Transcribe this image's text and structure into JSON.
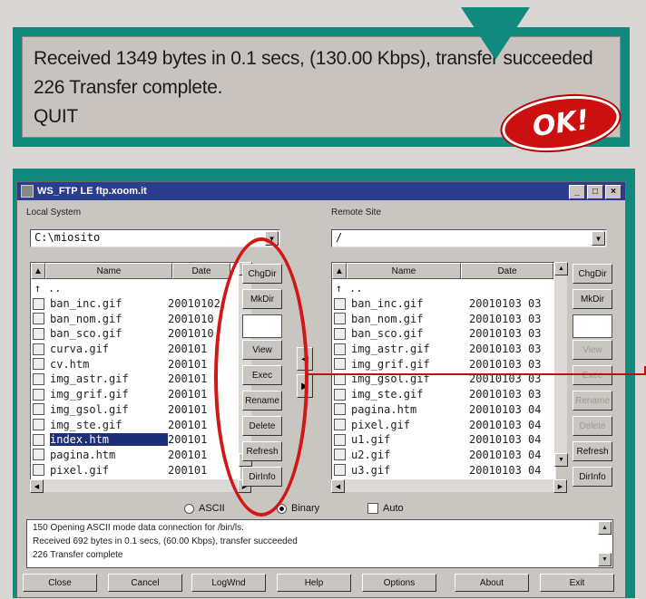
{
  "status": {
    "lines": [
      "Received 1349 bytes in 0.1 secs, (130.00 Kbps), transfer succeeded",
      "226 Transfer complete.",
      "QUIT"
    ],
    "badge": "OK!"
  },
  "window": {
    "title": "WS_FTP LE ftp.xoom.it",
    "controls": [
      "_",
      "□",
      "×"
    ]
  },
  "local": {
    "label": "Local System",
    "path": "C:\\miosito",
    "headers": [
      "Name",
      "Date"
    ],
    "files": [
      {
        "name": "..",
        "date": ""
      },
      {
        "name": "ban_inc.gif",
        "date": "20010102"
      },
      {
        "name": "ban_nom.gif",
        "date": "2001010"
      },
      {
        "name": "ban_sco.gif",
        "date": "2001010"
      },
      {
        "name": "curva.gif",
        "date": "200101"
      },
      {
        "name": "cv.htm",
        "date": "200101"
      },
      {
        "name": "img_astr.gif",
        "date": "200101"
      },
      {
        "name": "img_grif.gif",
        "date": "200101"
      },
      {
        "name": "img_gsol.gif",
        "date": "200101"
      },
      {
        "name": "img_ste.gif",
        "date": "200101"
      },
      {
        "name": "index.htm",
        "date": "200101"
      },
      {
        "name": "pagina.htm",
        "date": "200101"
      },
      {
        "name": "pixel.gif",
        "date": "200101"
      }
    ],
    "buttons": [
      "ChgDir",
      "MkDir",
      "",
      "View",
      "Exec",
      "Rename",
      "Delete",
      "Refresh",
      "DirInfo"
    ]
  },
  "remote": {
    "label": "Remote Site",
    "path": "/",
    "headers": [
      "Name",
      "Date"
    ],
    "files": [
      {
        "name": "..",
        "date": ""
      },
      {
        "name": "ban_inc.gif",
        "date": "20010103 03"
      },
      {
        "name": "ban_nom.gif",
        "date": "20010103 03"
      },
      {
        "name": "ban_sco.gif",
        "date": "20010103 03"
      },
      {
        "name": "img_astr.gif",
        "date": "20010103 03"
      },
      {
        "name": "img_grif.gif",
        "date": "20010103 03"
      },
      {
        "name": "img_gsol.gif",
        "date": "20010103 03"
      },
      {
        "name": "img_ste.gif",
        "date": "20010103 03"
      },
      {
        "name": "pagina.htm",
        "date": "20010103 04"
      },
      {
        "name": "pixel.gif",
        "date": "20010103 04"
      },
      {
        "name": "u1.gif",
        "date": "20010103 04"
      },
      {
        "name": "u2.gif",
        "date": "20010103 04"
      },
      {
        "name": "u3.gif",
        "date": "20010103 04"
      }
    ],
    "buttons": [
      "ChgDir",
      "MkDir",
      "",
      "View",
      "Exec",
      "Rename",
      "Delete",
      "Refresh",
      "DirInfo"
    ]
  },
  "mode": {
    "ascii": "ASCII",
    "binary": "Binary",
    "auto": "Auto",
    "selected": "Binary"
  },
  "log": [
    "150 Opening ASCII mode data connection for /bin/ls.",
    "Received 692 bytes in 0.1 secs, (60.00 Kbps), transfer succeeded",
    "226 Transfer complete"
  ],
  "bottom_buttons": [
    "Close",
    "Cancel",
    "LogWnd",
    "Help",
    "Options",
    "About",
    "Exit"
  ],
  "colors": {
    "accent": "#118a7e",
    "highlight": "#d01818",
    "titlebar": "#2a3d8f"
  }
}
